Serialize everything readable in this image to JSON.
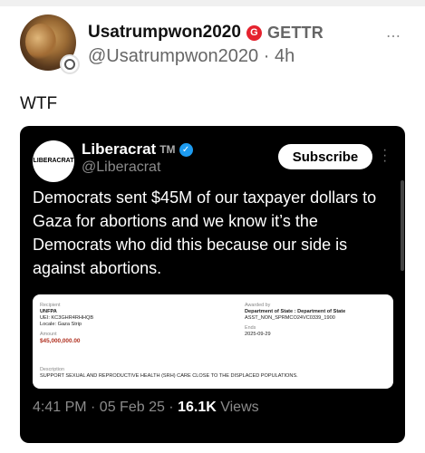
{
  "post": {
    "display_name": "Usatrumpwon2020",
    "platform_label": "GETTR",
    "handle": "@Usatrumpwon2020",
    "time_ago": "4h",
    "text": "WTF"
  },
  "embed": {
    "display_name": "Liberacrat",
    "tm": "TM",
    "handle": "@Liberacrat",
    "subscribe_label": "Subscribe",
    "text": "Democrats sent $45M of our taxpayer dollars to Gaza for abortions and we know it’s the Democrats who did this because our side is against abortions.",
    "timestamp": "4:41 PM · 05 Feb 25 · ",
    "views_count": "16.1K",
    "views_label": " Views",
    "card": {
      "recipient_label": "Recipient",
      "recipient_value": "UNFPA",
      "uei": "UEI: KC3GHR4RHHQB",
      "locale": "Locale: Gaza Strip",
      "amount_label": "Amount",
      "amount_value": "$45,000,000.00",
      "awarded_by_label": "Awarded by",
      "awarded_by_value": "Department of State : Department of State",
      "award_id": "ASST_NON_SPRMCO24VC0339_1900",
      "ends_label": "Ends",
      "ends_value": "2025-09-29",
      "description_label": "Description",
      "description_value": "SUPPORT SEXUAL AND REPRODUCTIVE HEALTH (SRH) CARE CLOSE TO THE DISPLACED POPULATIONS."
    }
  },
  "icons": {
    "more": "⋯",
    "verified": "✓",
    "gettr": "G"
  },
  "colors": {
    "gettr_red": "#e5222e",
    "verified_blue": "#1d9bf0",
    "embed_bg": "#000000",
    "amount_red": "#b03020"
  }
}
